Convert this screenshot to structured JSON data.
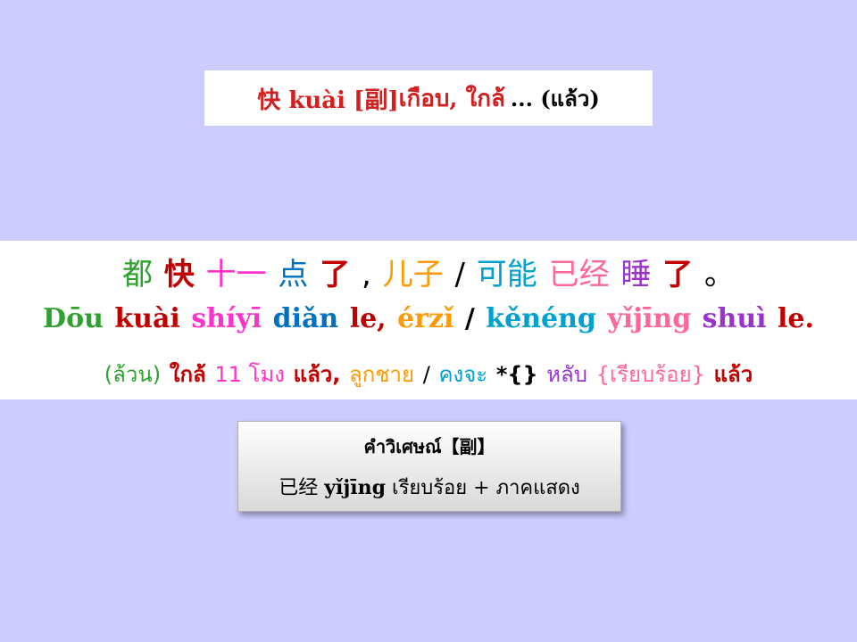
{
  "title": {
    "head": "快 kuài [副]",
    "rest": " เกือบ, ใกล้",
    "tail": "... (แล้ว)"
  },
  "sentence": {
    "hanzi": [
      {
        "text": "都",
        "color": "#2ea12e"
      },
      {
        "text": "快",
        "color": "#c00000"
      },
      {
        "text": "十一",
        "color": "#ff33cc"
      },
      {
        "text": "点",
        "color": "#0070c0"
      },
      {
        "text": "了",
        "color": "#c00000"
      },
      {
        "text": ",",
        "color": "#000000"
      },
      {
        "text": "儿子",
        "color": "#ff9900"
      },
      {
        "text": "/",
        "color": "#000000"
      },
      {
        "text": "可能",
        "color": "#00a0d0"
      },
      {
        "text": "已经",
        "color": "#ff6699"
      },
      {
        "text": "睡",
        "color": "#9933cc"
      },
      {
        "text": "了",
        "color": "#c00000"
      },
      {
        "text": "。",
        "color": "#000000"
      }
    ],
    "pinyin": [
      {
        "text": "Dōu",
        "color": "#2ea12e"
      },
      {
        "text": "kuài",
        "color": "#c00000"
      },
      {
        "text": "shíyī",
        "color": "#ff33cc"
      },
      {
        "text": "diǎn",
        "color": "#0070c0"
      },
      {
        "text": "le,",
        "color": "#c00000"
      },
      {
        "text": "érzǐ",
        "color": "#ff9900"
      },
      {
        "text": "/",
        "color": "#000000"
      },
      {
        "text": "kěnéng",
        "color": "#00a0d0"
      },
      {
        "text": "yǐjīng",
        "color": "#ff6699"
      },
      {
        "text": "shuì",
        "color": "#9933cc"
      },
      {
        "text": "le.",
        "color": "#c00000"
      }
    ],
    "thai": [
      {
        "text": "(ล้วน)",
        "color": "#2ea12e"
      },
      {
        "text": "ใกล้",
        "color": "#c00000"
      },
      {
        "text": "11 โมง",
        "color": "#ff33cc"
      },
      {
        "text": "แล้ว,",
        "color": "#c00000"
      },
      {
        "text": "ลูกชาย",
        "color": "#ff9900"
      },
      {
        "text": "/",
        "color": "#000000"
      },
      {
        "text": "คงจะ",
        "color": "#00a0d0"
      },
      {
        "text": "*{}",
        "color": "#000000"
      },
      {
        "text": "หลับ",
        "color": "#9933cc"
      },
      {
        "text": "{เรียบร้อย}",
        "color": "#ff6699"
      },
      {
        "text": "แล้ว",
        "color": "#c00000"
      }
    ]
  },
  "note": {
    "title": "คำวิเศษณ์【副】",
    "hanzi": "已经",
    "pinyin": "yǐjīng",
    "thai": "เรียบร้อย + ภาคแสดง"
  }
}
